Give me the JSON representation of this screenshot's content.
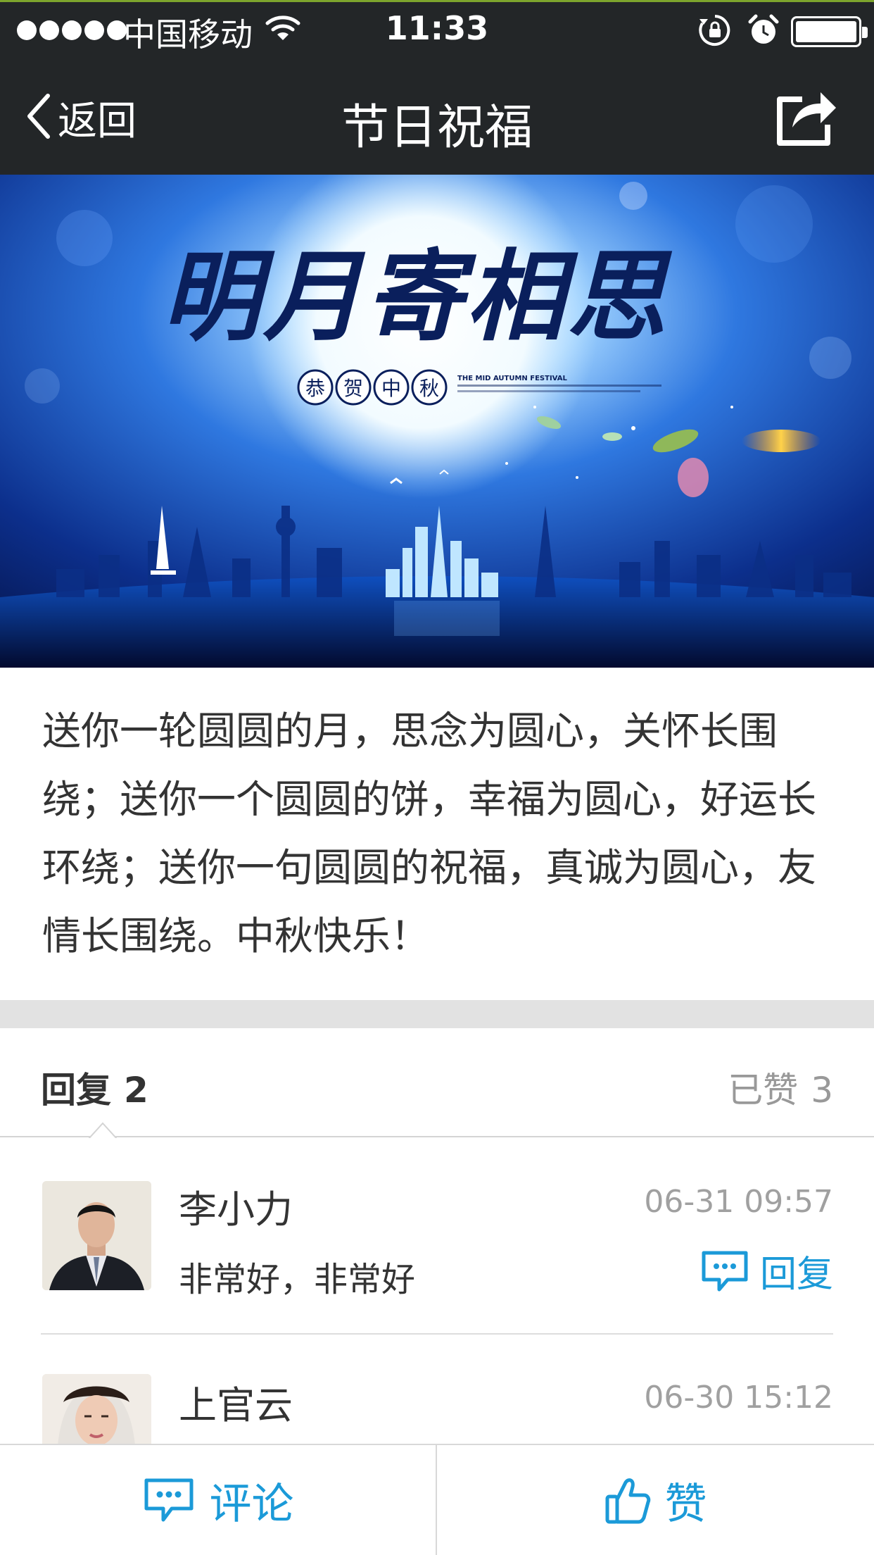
{
  "status_bar": {
    "carrier": "中国移动",
    "time": "11:33"
  },
  "nav": {
    "back_label": "返回",
    "title": "节日祝福"
  },
  "banner": {
    "headline": "明月寄相思",
    "seal_chars": [
      "恭",
      "贺",
      "中",
      "秋"
    ],
    "english_caption": "THE MID AUTUMN FESTIVAL"
  },
  "article": {
    "text": "送你一轮圆圆的月，思念为圆心，关怀长围绕；送你一个圆圆的饼，幸福为圆心，好运长环绕；送你一句圆圆的祝福，真诚为圆心，友情长围绕。中秋快乐！"
  },
  "replies_header": {
    "replies_label": "回复",
    "replies_count": "2",
    "likes_label": "已赞",
    "likes_count": "3"
  },
  "comments": [
    {
      "name": "李小力",
      "time": "06-31 09:57",
      "text": "非常好，非常好",
      "reply_label": "回复"
    },
    {
      "name": "上官云",
      "time": "06-30 15:12"
    }
  ],
  "bottom_bar": {
    "comment_label": "评论",
    "like_label": "赞"
  },
  "colors": {
    "topbar_bg": "#232628",
    "accent_blue": "#1b9ad8",
    "muted_gray": "#999999",
    "divider_band": "#e2e2e2"
  },
  "icons": {
    "wifi": "wifi-icon",
    "orientation_lock": "orientation-lock-icon",
    "alarm": "alarm-icon",
    "battery": "battery-icon",
    "back": "chevron-left-icon",
    "share": "share-icon",
    "comment": "speech-bubble-icon",
    "like": "thumbs-up-icon"
  }
}
